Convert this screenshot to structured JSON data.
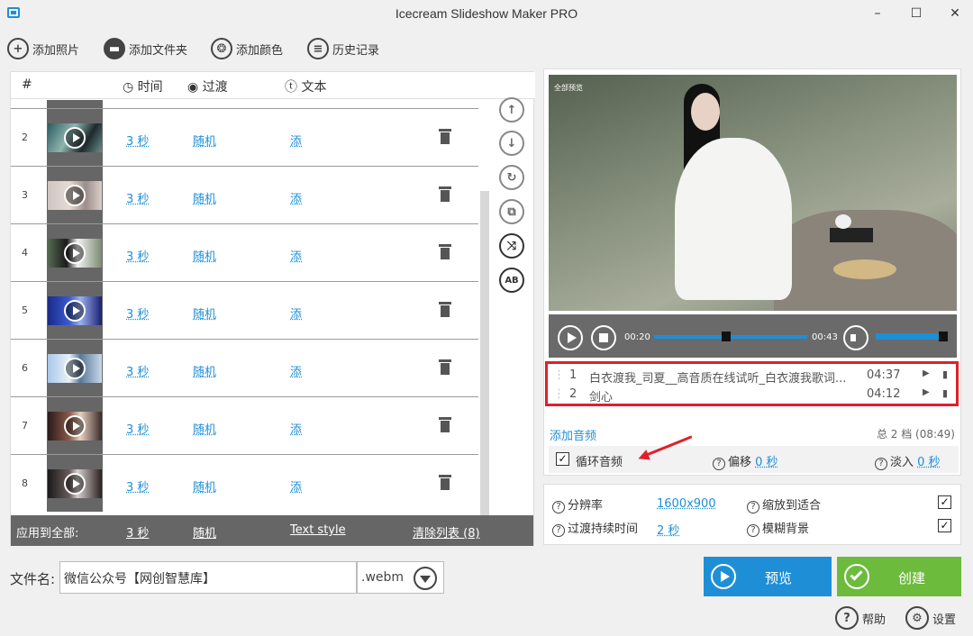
{
  "window": {
    "title": "Icecream Slideshow Maker PRO",
    "min": "–",
    "max": "☐",
    "close": "✕"
  },
  "toolbar": {
    "add_photo": "添加照片",
    "add_folder": "添加文件夹",
    "add_color": "添加颜色",
    "history": "历史记录"
  },
  "list": {
    "headers": {
      "num": "#",
      "time": "时间",
      "transition": "过渡",
      "text": "文本"
    },
    "rows": [
      {
        "num": "2",
        "time": "3 秒",
        "transition": "随机",
        "text": "添"
      },
      {
        "num": "3",
        "time": "3 秒",
        "transition": "随机",
        "text": "添"
      },
      {
        "num": "4",
        "time": "3 秒",
        "transition": "随机",
        "text": "添"
      },
      {
        "num": "5",
        "time": "3 秒",
        "transition": "随机",
        "text": "添"
      },
      {
        "num": "6",
        "time": "3 秒",
        "transition": "随机",
        "text": "添"
      },
      {
        "num": "7",
        "time": "3 秒",
        "transition": "随机",
        "text": "添"
      },
      {
        "num": "8",
        "time": "3 秒",
        "transition": "随机",
        "text": "添"
      }
    ],
    "apply": {
      "label": "应用到全部:",
      "time": "3 秒",
      "transition": "随机",
      "text_style": "Text style",
      "clear": "清除列表 (8)"
    }
  },
  "preview": {
    "label": "全部预览",
    "current_time": "00:20",
    "total_time": "00:43",
    "progress": 0.47,
    "volume": 0.9
  },
  "audio": {
    "tracks": [
      {
        "num": "1",
        "title": "白衣渡我_司夏__高音质在线试听_白衣渡我歌词...",
        "duration": "04:37"
      },
      {
        "num": "2",
        "title": "剑心",
        "duration": "04:12"
      }
    ],
    "add": "添加音频",
    "total": "总 2 档 (08:49)",
    "loop": "循环音频",
    "loop_checked": true,
    "offset_label": "偏移",
    "offset_value": "0 秒",
    "fadein_label": "淡入",
    "fadein_value": "0 秒"
  },
  "settings": {
    "resolution_label": "分辨率",
    "resolution_value": "1600x900",
    "transition_label": "过渡持续时间",
    "transition_value": "2 秒",
    "fit_label": "缩放到适合",
    "fit_checked": true,
    "blur_label": "模糊背景",
    "blur_checked": true
  },
  "output": {
    "filename_label": "文件名:",
    "filename": "微信公众号【网创智慧库】",
    "ext": ".webm"
  },
  "buttons": {
    "preview": "预览",
    "create": "创建",
    "help": "帮助",
    "settings": "设置"
  },
  "colors": {
    "accent": "#1e8fd6",
    "create": "#6cbb3c",
    "highlight": "#e0202a",
    "dark_row": "#666666"
  }
}
